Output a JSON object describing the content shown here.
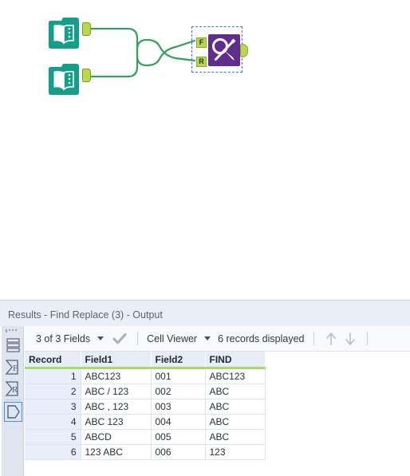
{
  "canvas": {
    "nodes": [
      {
        "name": "Input Data",
        "type": "input-data",
        "icon": "book-icon"
      },
      {
        "name": "Input Data",
        "type": "input-data",
        "icon": "book-icon"
      },
      {
        "name": "Find Replace",
        "type": "find-replace",
        "icon": "magnifier-pencil-icon",
        "selected": true
      }
    ],
    "find_replace": {
      "input_anchor_find_label": "F",
      "input_anchor_replace_label": "R"
    },
    "colors": {
      "input_node": "#159e8c",
      "tool_node": "#622c8f",
      "anchor": "#b9d94a",
      "connection": "#35a05a",
      "selection": "#2a7ade"
    }
  },
  "results": {
    "title": "Results - Find Replace (3) - Output",
    "toolbar": {
      "fields_label": "3 of 3 Fields",
      "view_label": "Cell Viewer",
      "records_label": "6 records displayed",
      "check_icon": "checkmark-icon",
      "up_icon": "arrow-up-icon",
      "down_icon": "arrow-down-icon"
    },
    "rail": {
      "items": [
        {
          "name": "table-view",
          "label": ""
        },
        {
          "name": "fields-view",
          "label": "F"
        },
        {
          "name": "records-view",
          "label": "R"
        },
        {
          "name": "data-view",
          "label": "",
          "selected": true
        }
      ]
    },
    "table": {
      "columns": [
        "Record",
        "Field1",
        "Field2",
        "FIND"
      ],
      "rows": [
        {
          "record": "1",
          "field1": "ABC123",
          "field2": "001",
          "find": "ABC123"
        },
        {
          "record": "2",
          "field1": "ABC / 123",
          "field2": "002",
          "find": "ABC"
        },
        {
          "record": "3",
          "field1": "ABC , 123",
          "field2": "003",
          "find": "ABC"
        },
        {
          "record": "4",
          "field1": "ABC 123",
          "field2": "004",
          "find": "ABC"
        },
        {
          "record": "5",
          "field1": "ABCD",
          "field2": "005",
          "find": "ABC"
        },
        {
          "record": "6",
          "field1": "123 ABC",
          "field2": "006",
          "find": "123"
        }
      ]
    }
  }
}
